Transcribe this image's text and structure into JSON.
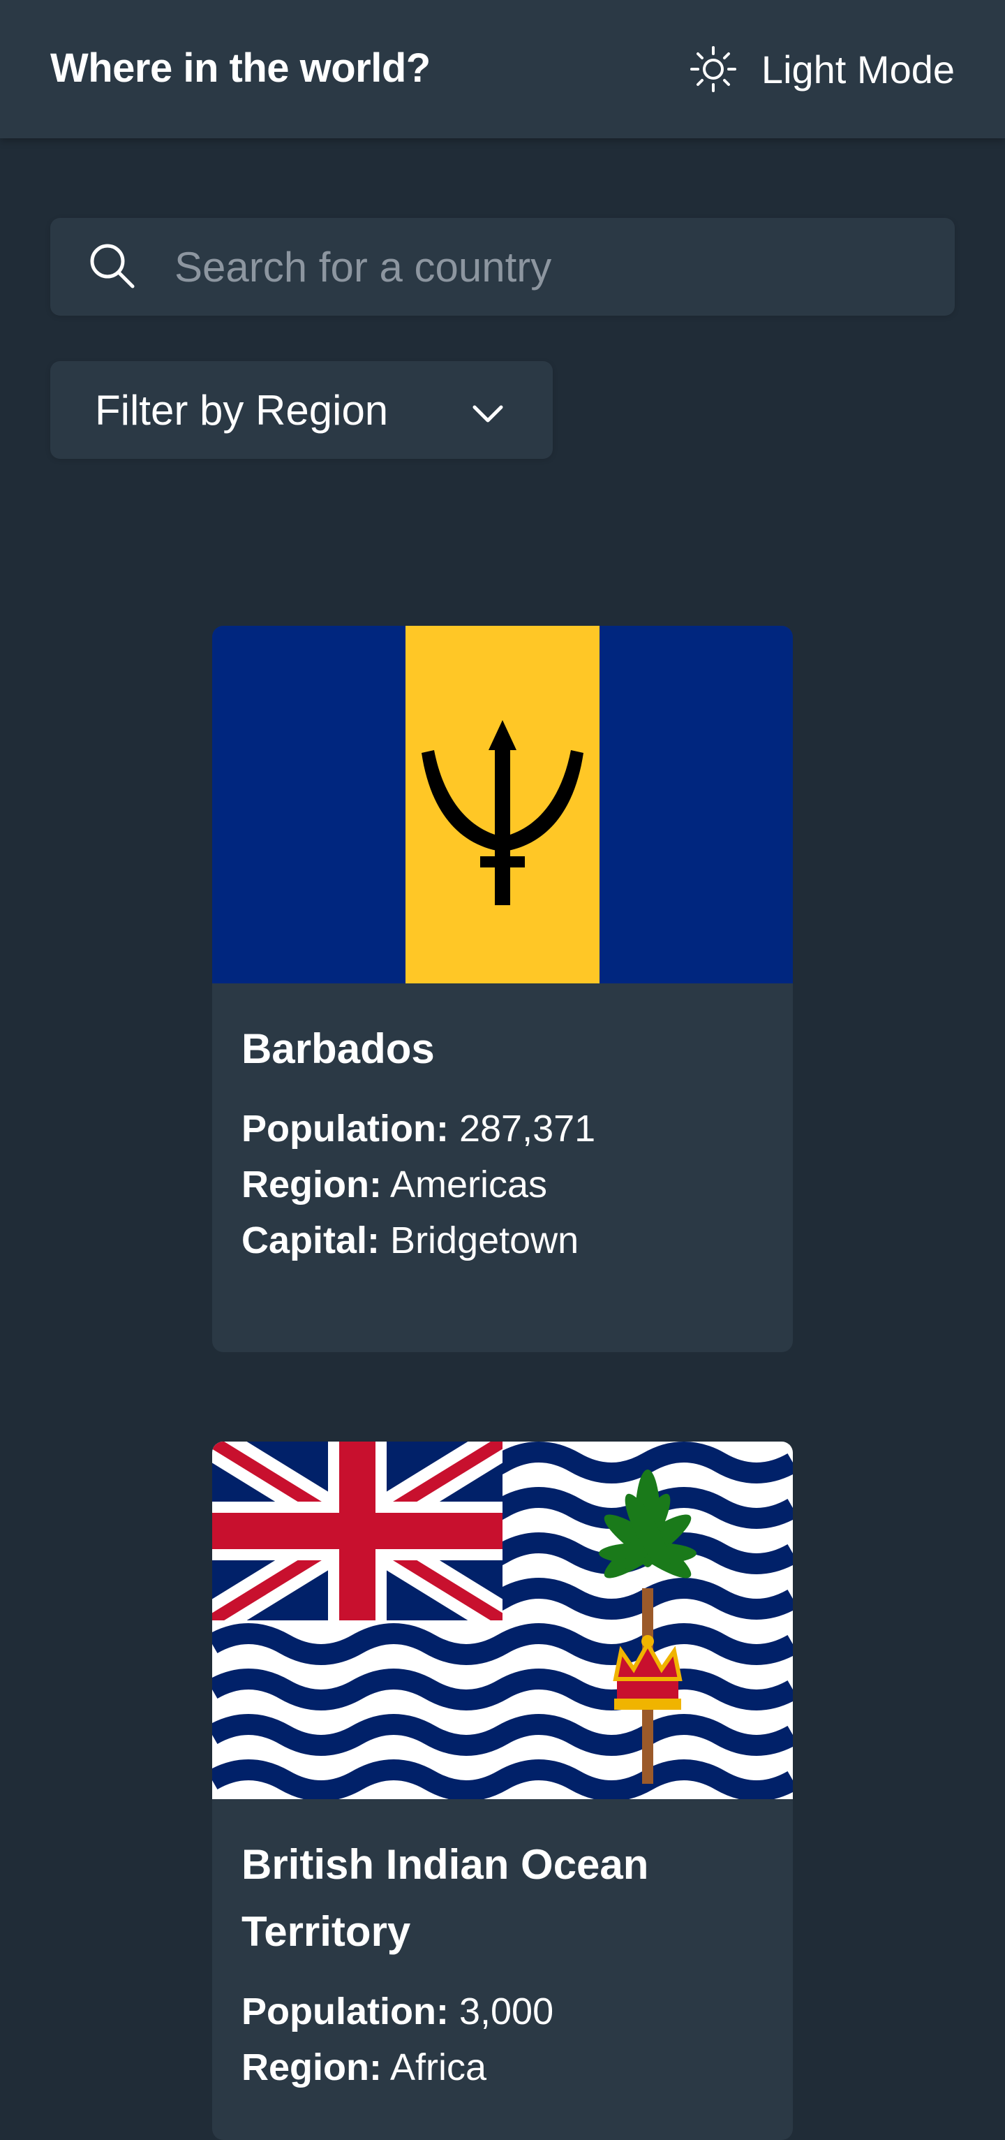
{
  "header": {
    "title": "Where in the world?",
    "theme_label": "Light Mode"
  },
  "search": {
    "placeholder": "Search for a country",
    "value": ""
  },
  "filter": {
    "label": "Filter by Region"
  },
  "countries": [
    {
      "name": "Barbados",
      "population_label": "Population:",
      "population": "287,371",
      "region_label": "Region:",
      "region": "Americas",
      "capital_label": "Capital:",
      "capital": "Bridgetown"
    },
    {
      "name": "British Indian Ocean Territory",
      "population_label": "Population:",
      "population": "3,000",
      "region_label": "Region:",
      "region": "Africa"
    }
  ],
  "colors": {
    "background": "#202c37",
    "surface": "#2b3945",
    "text": "#ffffff",
    "placeholder": "#8d96a0"
  },
  "icons": {
    "theme": "sun-icon",
    "search": "search-icon",
    "filter": "chevron-down-icon"
  }
}
